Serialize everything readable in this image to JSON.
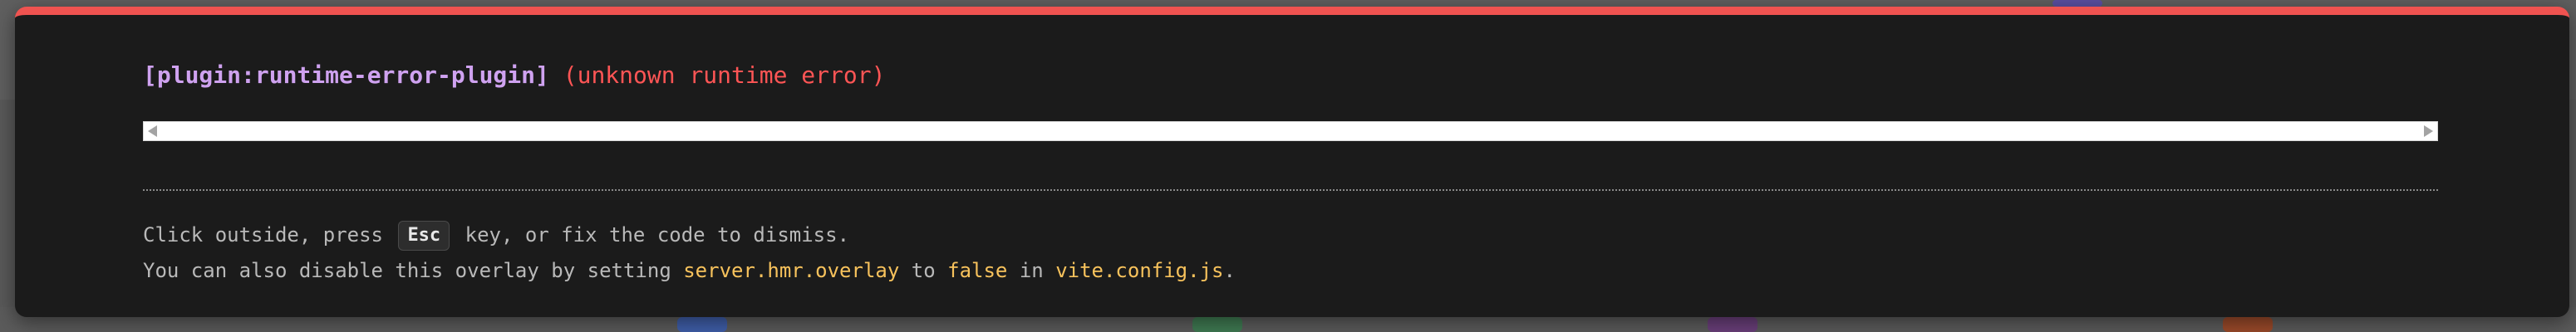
{
  "overlay": {
    "plugin_tag": "[plugin:runtime-error-plugin]",
    "error_message": "(unknown runtime error)",
    "tip_line1_before": "Click outside, press",
    "tip_line1_key": "Esc",
    "tip_line1_after": "key, or fix the code to dismiss.",
    "tip_line2_part1": "You can also disable this overlay by setting",
    "tip_line2_code1": "server.hmr.overlay",
    "tip_line2_part2": "to",
    "tip_line2_code2": "false",
    "tip_line2_part3": "in",
    "tip_line2_code3": "vite.config.js",
    "tip_line2_end": "."
  },
  "colors": {
    "accent_top_border": "#ef5350",
    "plugin_text": "#cfa2f0",
    "error_text": "#ff5555",
    "code_highlight": "#f7c25c",
    "overlay_bg": "#1b1b1b"
  },
  "icons": {
    "scroll_left": "triangle-left-icon",
    "scroll_right": "triangle-right-icon"
  }
}
